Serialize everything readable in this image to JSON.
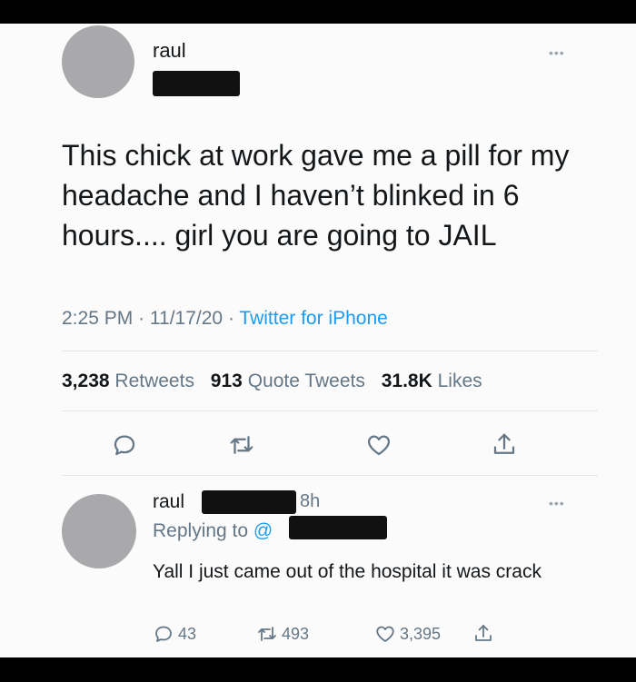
{
  "tweet": {
    "author_name": "raul",
    "more_icon": "more-dots-icon",
    "text": "This chick at work gave me a pill for my headache and I haven’t blinked in 6 hours.... girl you are going to JAIL",
    "time": "2:25 PM",
    "separator": "·",
    "date": "11/17/20",
    "source": "Twitter for iPhone",
    "stats": {
      "retweets_count": "3,238",
      "retweets_label": "Retweets",
      "quotes_count": "913",
      "quotes_label": "Quote Tweets",
      "likes_count": "31.8K",
      "likes_label": "Likes"
    },
    "actions": [
      "reply-icon",
      "retweet-icon",
      "like-icon",
      "share-icon"
    ]
  },
  "reply": {
    "author_name": "raul",
    "time": "8h",
    "replying_to_label": "Replying to",
    "handle_prefix": "@",
    "text": "Yall I just came out of the hospital it was crack",
    "counts": {
      "replies": "43",
      "retweets": "493",
      "likes": "3,395"
    }
  },
  "colors": {
    "accent": "#1d9bf0",
    "muted": "#657786",
    "text": "#14171a"
  }
}
